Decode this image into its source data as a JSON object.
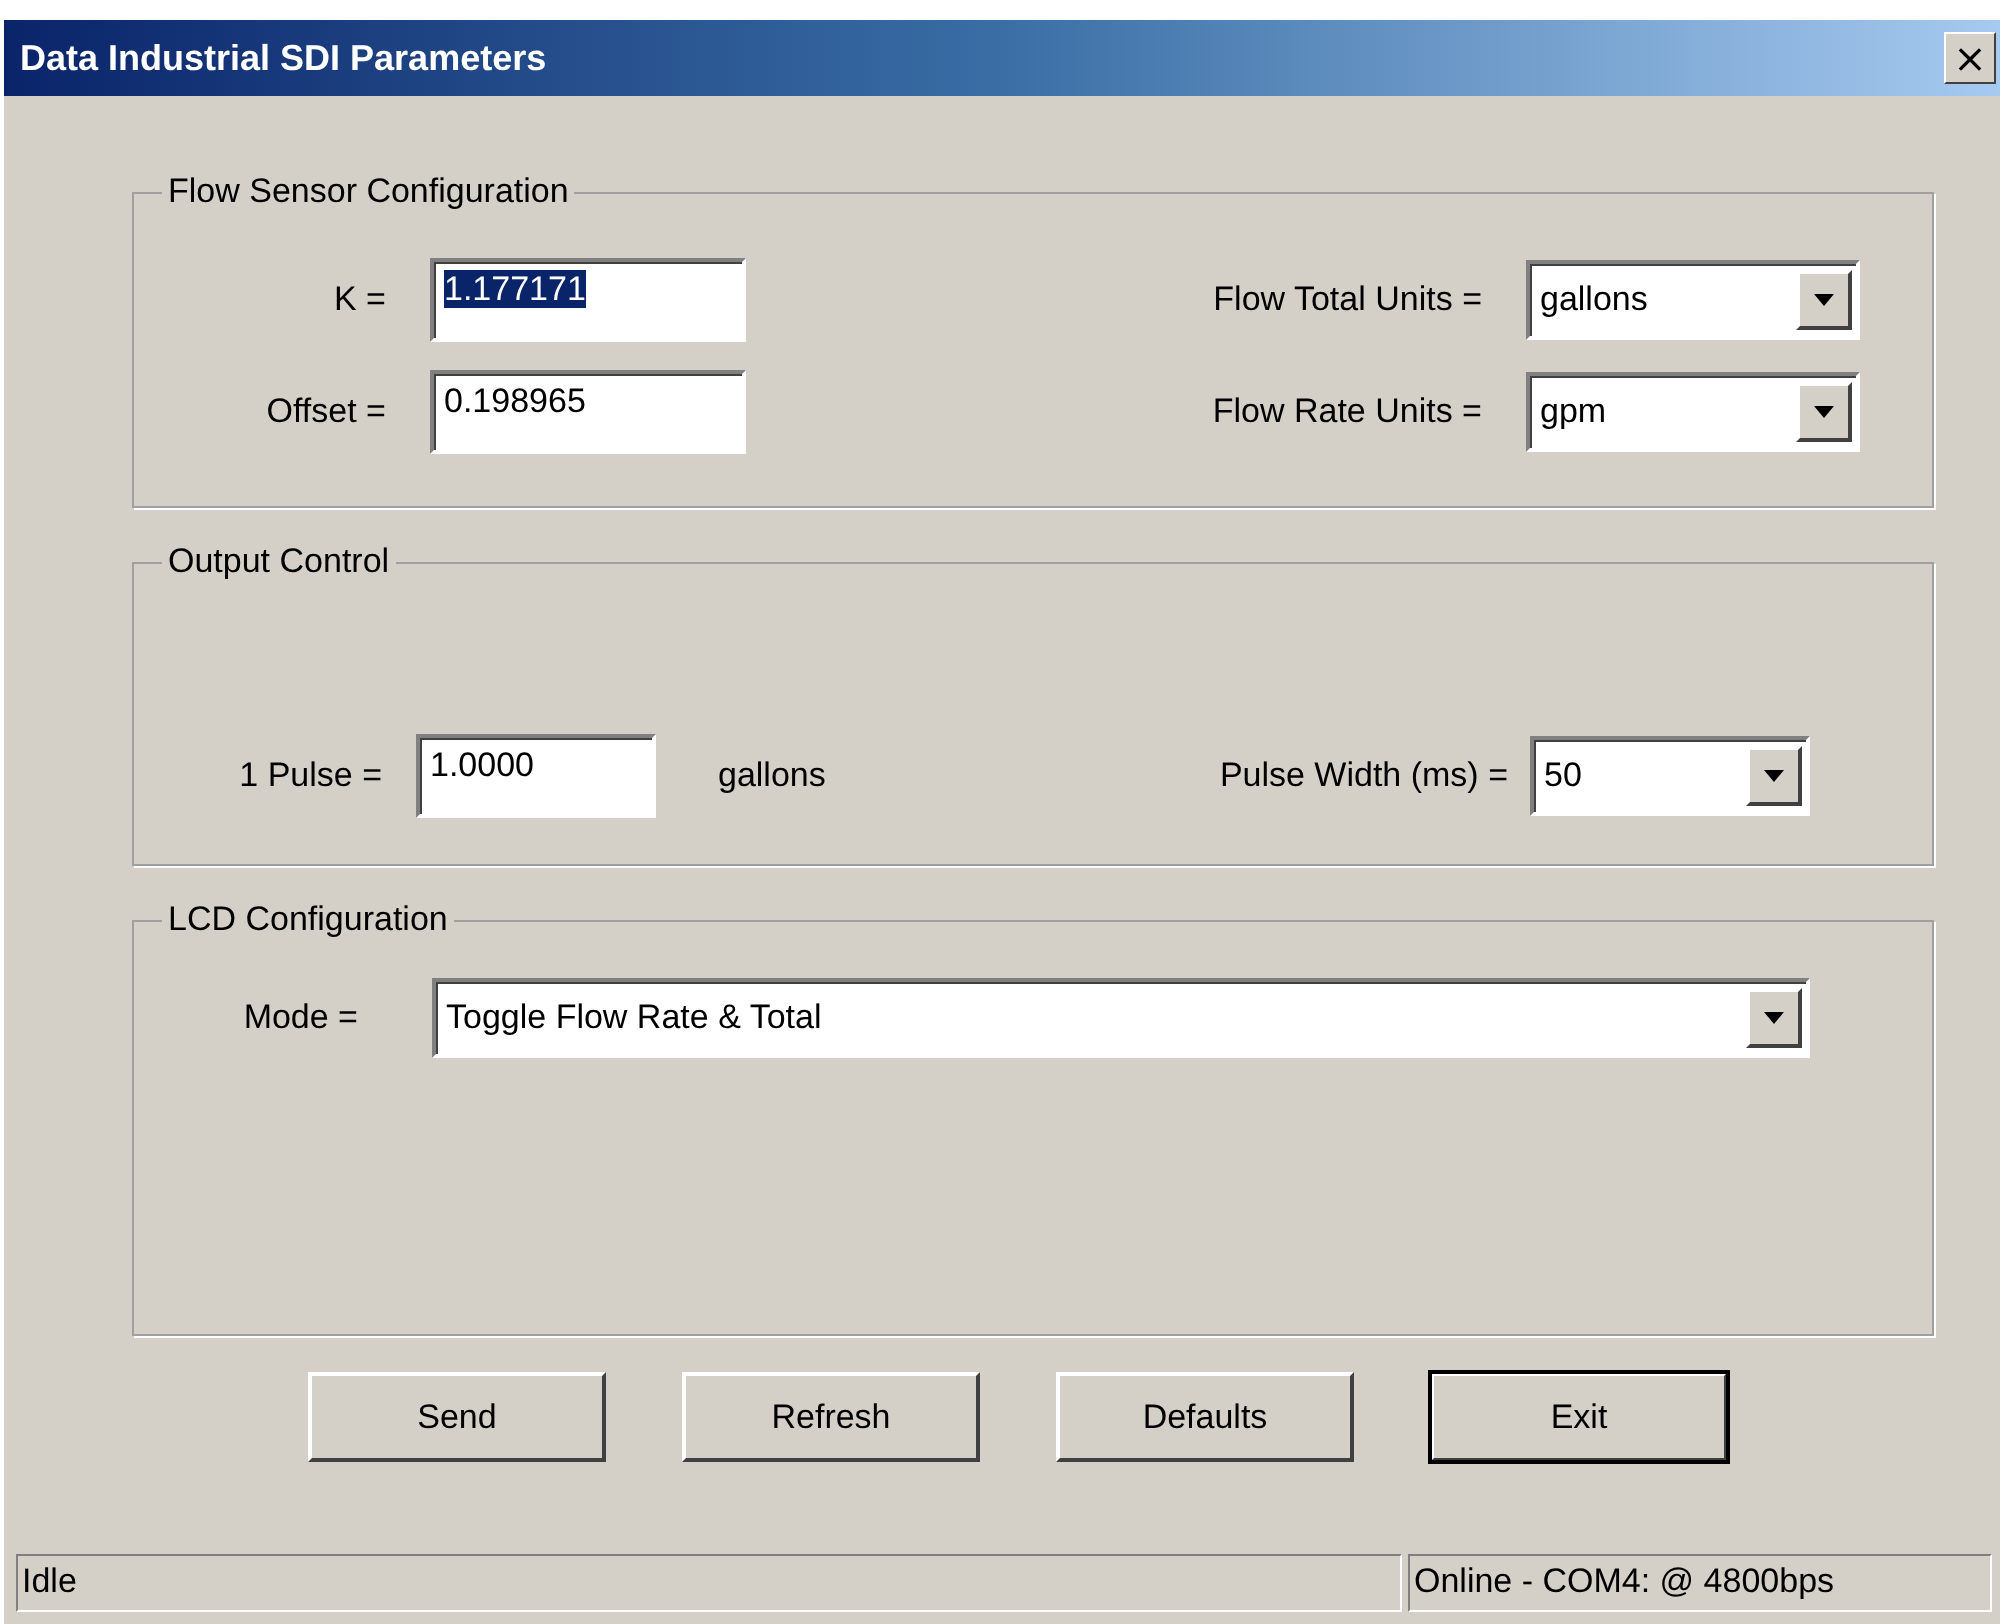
{
  "window": {
    "title": "Data Industrial SDI Parameters",
    "close": "×"
  },
  "flow_sensor": {
    "title": "Flow Sensor Configuration",
    "fields": [
      {
        "label": "K =",
        "value": "1.177171",
        "highlighted": true
      },
      {
        "label": "Offset =",
        "value": "0.198965",
        "highlighted": false
      }
    ],
    "dropdowns": [
      {
        "label": "Flow Total Units =",
        "value": "gallons"
      },
      {
        "label": "Flow Rate Units =",
        "value": "gpm"
      }
    ]
  },
  "output_control": {
    "title": "Output Control",
    "pulse_label": "1 Pulse =",
    "pulse_value": "1.0000",
    "pulse_unit": "gallons",
    "width_label": "Pulse Width (ms) =",
    "width_value": "50"
  },
  "lcd": {
    "title": "LCD Configuration",
    "mode_label": "Mode =",
    "mode_value": "Toggle Flow Rate & Total"
  },
  "buttons": [
    {
      "label": "Send",
      "default": false
    },
    {
      "label": "Refresh",
      "default": false
    },
    {
      "label": "Defaults",
      "default": false
    },
    {
      "label": "Exit",
      "default": true
    }
  ],
  "status_bar": {
    "left": "Idle",
    "right": "Online - COM4: @ 4800bps"
  }
}
